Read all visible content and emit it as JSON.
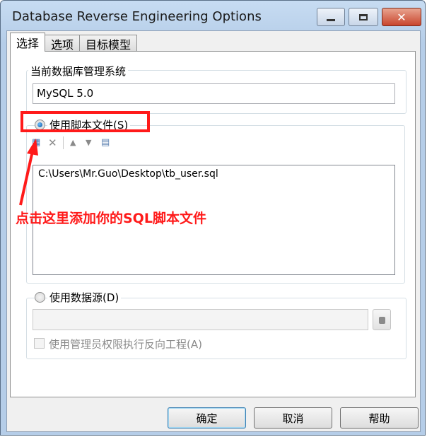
{
  "window": {
    "title": "Database Reverse Engineering Options"
  },
  "tabs": [
    {
      "label": "选择"
    },
    {
      "label": "选项"
    },
    {
      "label": "目标模型"
    }
  ],
  "dbms": {
    "label": "当前数据库管理系统",
    "value": "MySQL 5.0"
  },
  "script_option": {
    "label": "使用脚本文件(S)",
    "selected": true,
    "files": [
      "C:\\Users\\Mr.Guo\\Desktop\\tb_user.sql"
    ]
  },
  "datasource_option": {
    "label": "使用数据源(D)",
    "selected": false,
    "value": ""
  },
  "admin_checkbox": {
    "label": "使用管理员权限执行反向工程(A)",
    "checked": false
  },
  "annotation": {
    "text": "点击这里添加你的SQL脚本文件"
  },
  "buttons": {
    "ok": "确定",
    "cancel": "取消",
    "help": "帮助"
  },
  "colors": {
    "annotation_red": "#ff1a1a"
  }
}
